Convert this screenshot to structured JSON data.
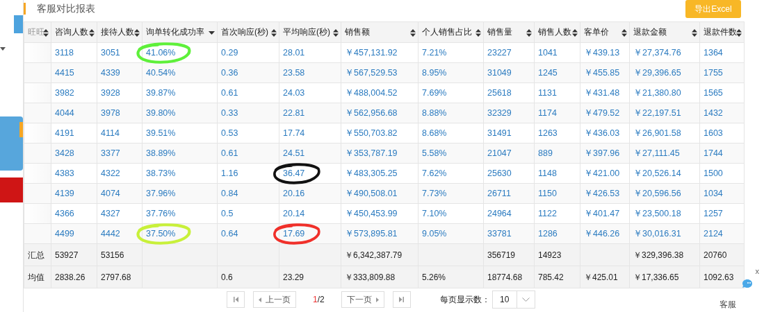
{
  "title": "客服对比报表",
  "export_button": "导出Excel",
  "table": {
    "columns": [
      {
        "label": "旺旺",
        "sorted": false
      },
      {
        "label": "咨询人数",
        "sorted": false
      },
      {
        "label": "接待人数",
        "sorted": false
      },
      {
        "label": "询单转化成功率",
        "sorted": true
      },
      {
        "label": "首次响应(秒)",
        "sorted": false
      },
      {
        "label": "平均响应(秒)",
        "sorted": false
      },
      {
        "label": "销售额",
        "sorted": false
      },
      {
        "label": "个人销售占比",
        "sorted": false
      },
      {
        "label": "销售量",
        "sorted": false
      },
      {
        "label": "销售人数",
        "sorted": false
      },
      {
        "label": "客单价",
        "sorted": false
      },
      {
        "label": "退款金额",
        "sorted": false
      },
      {
        "label": "退款件数",
        "sorted": false
      }
    ],
    "rows": [
      {
        "cells": [
          {
            "text": ""
          },
          {
            "text": "3118"
          },
          {
            "text": "3051"
          },
          {
            "text": "41.06%",
            "color": "#5ef03a"
          },
          {
            "text": "0.29"
          },
          {
            "text": "28.01"
          },
          {
            "text": "￥457,131.92"
          },
          {
            "text": "7.21%"
          },
          {
            "text": "23227"
          },
          {
            "text": "1041"
          },
          {
            "text": "￥439.13"
          },
          {
            "text": "￥27,374.76"
          },
          {
            "text": "1364"
          }
        ]
      },
      {
        "cells": [
          {
            "text": ""
          },
          {
            "text": "4415"
          },
          {
            "text": "4339"
          },
          {
            "text": "40.54%"
          },
          {
            "text": "0.36"
          },
          {
            "text": "23.58"
          },
          {
            "text": "￥567,529.53"
          },
          {
            "text": "8.95%"
          },
          {
            "text": "31049"
          },
          {
            "text": "1245"
          },
          {
            "text": "￥455.85"
          },
          {
            "text": "￥29,396.65"
          },
          {
            "text": "1755"
          }
        ]
      },
      {
        "cells": [
          {
            "text": ""
          },
          {
            "text": "3982"
          },
          {
            "text": "3928"
          },
          {
            "text": "39.87%"
          },
          {
            "text": "0.61"
          },
          {
            "text": "24.03"
          },
          {
            "text": "￥488,004.52"
          },
          {
            "text": "7.69%"
          },
          {
            "text": "25618"
          },
          {
            "text": "1131"
          },
          {
            "text": "￥431.48"
          },
          {
            "text": "￥21,380.80"
          },
          {
            "text": "1565"
          }
        ]
      },
      {
        "cells": [
          {
            "text": ""
          },
          {
            "text": "4044"
          },
          {
            "text": "3978"
          },
          {
            "text": "39.80%"
          },
          {
            "text": "0.33"
          },
          {
            "text": "22.81"
          },
          {
            "text": "￥562,956.68"
          },
          {
            "text": "8.88%"
          },
          {
            "text": "32329"
          },
          {
            "text": "1174"
          },
          {
            "text": "￥479.52"
          },
          {
            "text": "￥22,197.51"
          },
          {
            "text": "1432"
          }
        ]
      },
      {
        "cells": [
          {
            "text": ""
          },
          {
            "text": "4191"
          },
          {
            "text": "4114"
          },
          {
            "text": "39.51%"
          },
          {
            "text": "0.53"
          },
          {
            "text": "17.74"
          },
          {
            "text": "￥550,703.82"
          },
          {
            "text": "8.68%"
          },
          {
            "text": "31491"
          },
          {
            "text": "1263"
          },
          {
            "text": "￥436.03"
          },
          {
            "text": "￥26,901.58"
          },
          {
            "text": "1603"
          }
        ]
      },
      {
        "cells": [
          {
            "text": ""
          },
          {
            "text": "3428"
          },
          {
            "text": "3377"
          },
          {
            "text": "38.89%"
          },
          {
            "text": "0.61"
          },
          {
            "text": "24.51"
          },
          {
            "text": "￥353,787.19"
          },
          {
            "text": "5.58%"
          },
          {
            "text": "21047"
          },
          {
            "text": "889"
          },
          {
            "text": "￥397.96"
          },
          {
            "text": "￥27,111.45"
          },
          {
            "text": "1744"
          }
        ]
      },
      {
        "cells": [
          {
            "text": ""
          },
          {
            "text": "4383"
          },
          {
            "text": "4322"
          },
          {
            "text": "38.73%"
          },
          {
            "text": "1.16"
          },
          {
            "text": "36.47",
            "color": "#111111"
          },
          {
            "text": "￥483,305.25"
          },
          {
            "text": "7.62%"
          },
          {
            "text": "25630"
          },
          {
            "text": "1148"
          },
          {
            "text": "￥421.00"
          },
          {
            "text": "￥20,526.14"
          },
          {
            "text": "1500"
          }
        ]
      },
      {
        "cells": [
          {
            "text": ""
          },
          {
            "text": "4139"
          },
          {
            "text": "4074"
          },
          {
            "text": "37.96%"
          },
          {
            "text": "0.84"
          },
          {
            "text": "20.16"
          },
          {
            "text": "￥490,508.01"
          },
          {
            "text": "7.73%"
          },
          {
            "text": "26711"
          },
          {
            "text": "1150"
          },
          {
            "text": "￥426.53"
          },
          {
            "text": "￥20,596.56"
          },
          {
            "text": "1034"
          }
        ]
      },
      {
        "cells": [
          {
            "text": ""
          },
          {
            "text": "4366"
          },
          {
            "text": "4327"
          },
          {
            "text": "37.76%"
          },
          {
            "text": "0.5"
          },
          {
            "text": "20.14"
          },
          {
            "text": "￥450,453.99"
          },
          {
            "text": "7.10%"
          },
          {
            "text": "24964"
          },
          {
            "text": "1122"
          },
          {
            "text": "￥401.47"
          },
          {
            "text": "￥23,500.18"
          },
          {
            "text": "1257"
          }
        ]
      },
      {
        "cells": [
          {
            "text": ""
          },
          {
            "text": "4499"
          },
          {
            "text": "4442"
          },
          {
            "text": "37.50%",
            "color": "#c8f03a"
          },
          {
            "text": "0.64"
          },
          {
            "text": "17.69",
            "color": "#f0302a"
          },
          {
            "text": "￥573,895.81"
          },
          {
            "text": "9.05%"
          },
          {
            "text": "33781"
          },
          {
            "text": "1286"
          },
          {
            "text": "￥446.26"
          },
          {
            "text": "￥30,016.31"
          },
          {
            "text": "2124"
          }
        ]
      }
    ],
    "summary_rows": [
      {
        "label": "汇总",
        "cells": [
          "53927",
          "53156",
          null,
          null,
          null,
          "￥6,342,387.79",
          null,
          "356719",
          "14923",
          null,
          "￥329,396.38",
          "20760"
        ]
      },
      {
        "label": "均值",
        "cells": [
          "2838.26",
          "2797.68",
          null,
          "0.6",
          "23.29",
          "￥333,809.88",
          "5.26%",
          "18774.68",
          "785.42",
          "￥425.01",
          "￥17,336.65",
          "1092.63"
        ]
      }
    ]
  },
  "pagination": {
    "previous": "上一页",
    "current_page": "1",
    "total_pages": "/2",
    "next": "下一页",
    "page_size_label": "每页显示数：",
    "page_size": "10"
  },
  "chat_widget": {
    "close": "x",
    "label": "客服"
  }
}
